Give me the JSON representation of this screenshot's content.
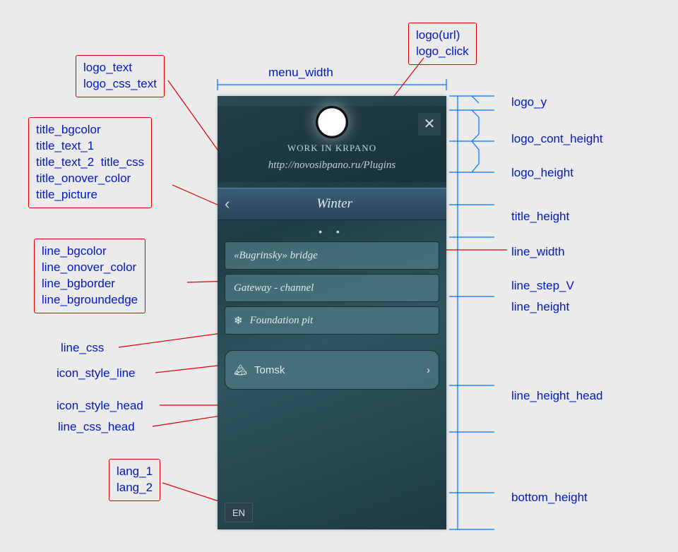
{
  "logo": {
    "text": "WORK IN KRPANO",
    "url": "http://novosibpano.ru/Plugins"
  },
  "close_glyph": "✕",
  "title": {
    "back_glyph": "‹",
    "text": "Winter"
  },
  "dots": "•  •",
  "lines": {
    "bugrinsky": "«Bugrinsky» bridge",
    "gateway": "Gateway - channel",
    "foundation": "Foundation pit",
    "tomsk": "Tomsk",
    "snow_icon": "❄",
    "mtn_icon": "🏔",
    "chev": "›"
  },
  "lang": "EN",
  "labels": {
    "menu_width": "menu_width",
    "logo_text_box": "logo_text\nlogo_css_text",
    "logo_url_box": "logo(url)\nlogo_click",
    "title_box": "title_bgcolor\ntitle_text_1\ntitle_text_2  title_css\ntitle_onover_color\ntitle_picture",
    "line_box": "line_bgcolor\nline_onover_color\nline_bgborder\nline_bgroundedge",
    "line_css": "line_css",
    "icon_style_line": "icon_style_line",
    "icon_style_head": "icon_style_head",
    "line_css_head": "line_css_head",
    "lang_box": "lang_1\nlang_2",
    "logo_y": "logo_y",
    "logo_cont_height": "logo_cont_height",
    "logo_height": "logo_height",
    "title_height": "title_height",
    "line_width": "line_width",
    "line_step_V": "line_step_V",
    "line_height": "line_height",
    "line_height_head": "line_height_head",
    "bottom_height": "bottom_height"
  }
}
